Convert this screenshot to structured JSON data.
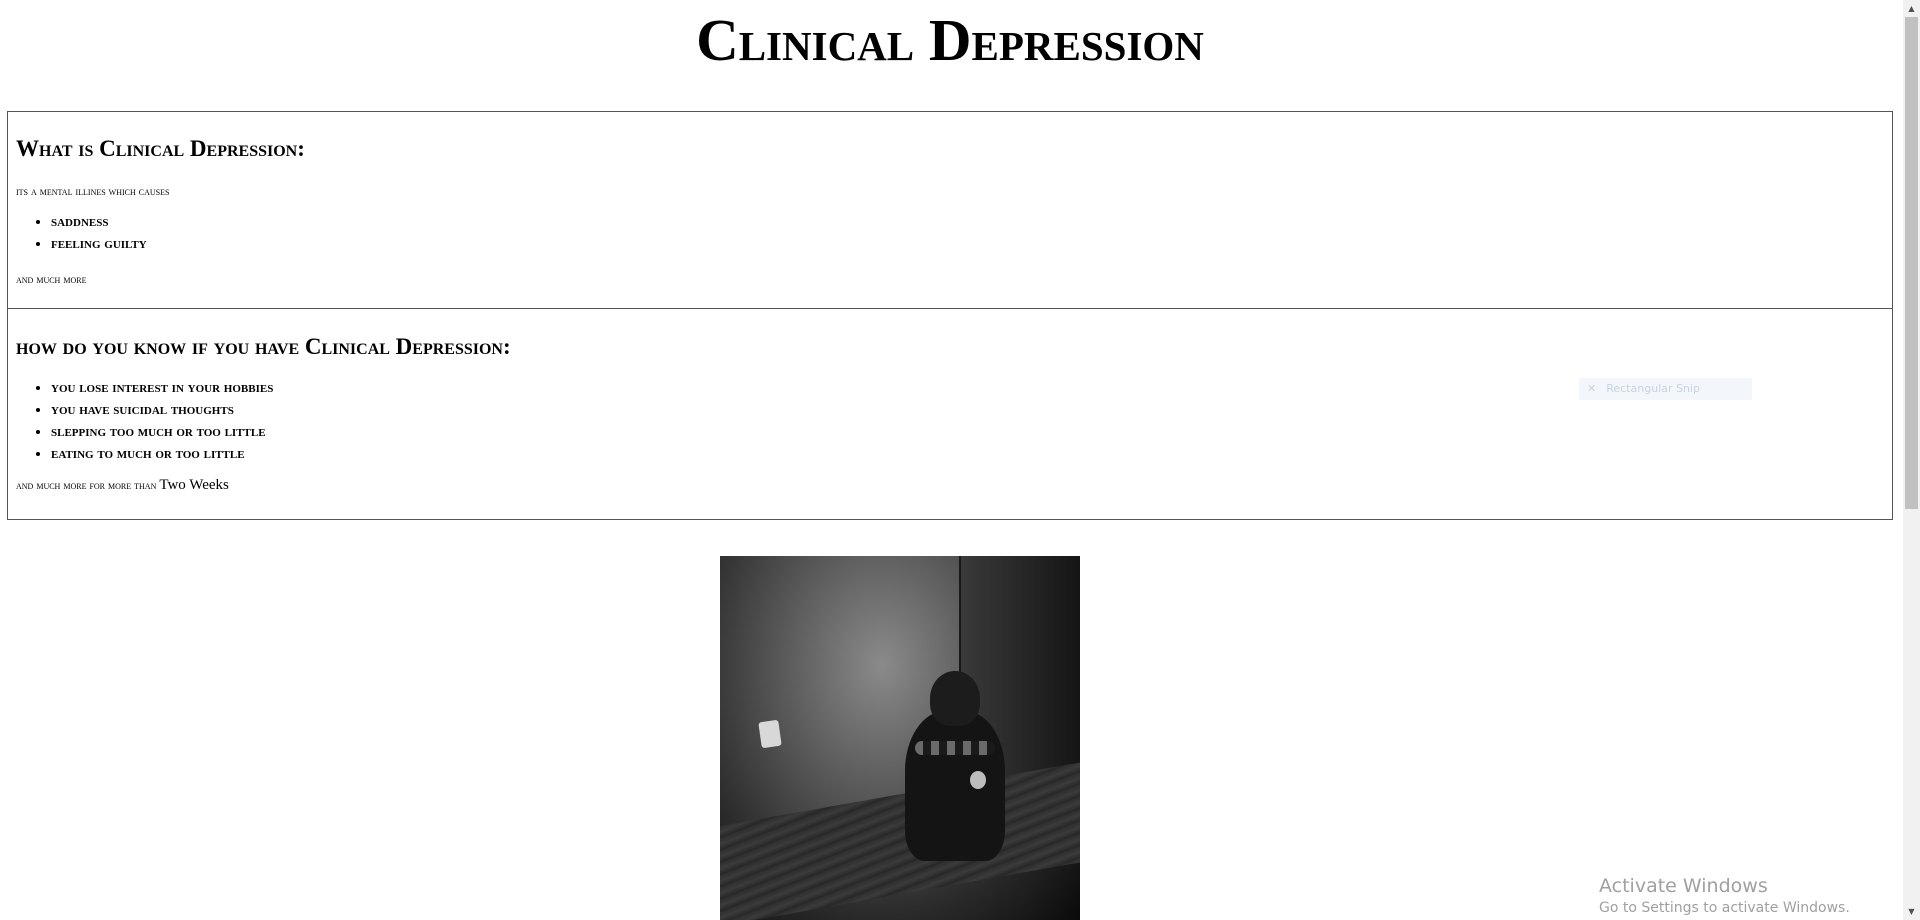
{
  "page": {
    "title": "Clinical Depression"
  },
  "section_what": {
    "heading": "What is Clinical Depression:",
    "intro": "its a mental illines which causes",
    "items": [
      "saddness",
      "feeling guilty"
    ],
    "outro": "and much more"
  },
  "section_how": {
    "heading": "how do you know if you have Clinical Depression:",
    "items": [
      "you lose interest in your hobbies",
      "you have suicidal thoughts",
      "slepping too much or too little",
      "eating to much or too little"
    ],
    "outro_prefix": "and much more for more than ",
    "outro_emphasis": "Two Weeks"
  },
  "overlay": {
    "snip_icon": "x-icon",
    "snip_label": "Rectangular Snip",
    "activate_title": "Activate Windows",
    "activate_subtitle": "Go to Settings to activate Windows."
  },
  "scrollbar": {
    "up_icon": "▲",
    "down_icon": "▼"
  }
}
